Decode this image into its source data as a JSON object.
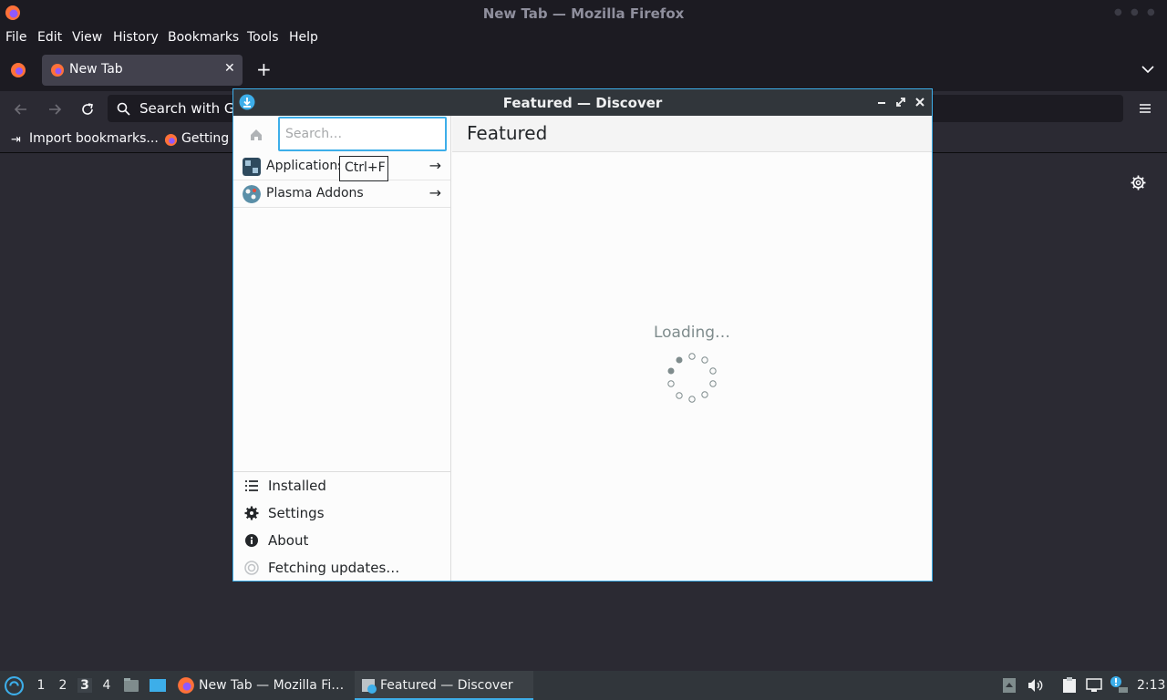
{
  "firefox": {
    "window_title": "New Tab — Mozilla Firefox",
    "menu": [
      "File",
      "Edit",
      "View",
      "History",
      "Bookmarks",
      "Tools",
      "Help"
    ],
    "tab": {
      "label": "New Tab"
    },
    "new_tab_symbol": "+",
    "urlbar": {
      "text": "Search with Go"
    },
    "bookmarks": [
      "Import bookmarks...",
      "Getting s"
    ]
  },
  "discover": {
    "window_title": "Featured — Discover",
    "search": {
      "placeholder": "Search…",
      "value": ""
    },
    "tooltip": "Ctrl+F",
    "categories": [
      {
        "label": "Applications",
        "icon": "applications-icon"
      },
      {
        "label": "Plasma Addons",
        "icon": "plasma-addons-icon"
      }
    ],
    "bottom_items": [
      {
        "label": "Installed",
        "icon": "list-icon"
      },
      {
        "label": "Settings",
        "icon": "gear-icon"
      },
      {
        "label": "About",
        "icon": "info-icon"
      },
      {
        "label": "Fetching updates…",
        "icon": "update-icon"
      }
    ],
    "page_title": "Featured",
    "loading_text": "Loading…"
  },
  "taskbar": {
    "desktops": [
      "1",
      "2",
      "3",
      "4"
    ],
    "active_desktop": "3",
    "tasks": [
      {
        "label": "New Tab — Mozilla Fi…",
        "icon": "firefox-icon"
      },
      {
        "label": "Featured — Discover",
        "icon": "discover-icon"
      }
    ],
    "clock": "2:13"
  },
  "colors": {
    "accent": "#3daee9",
    "firefox_bg": "#1c1b22",
    "panel": "#31363b"
  }
}
